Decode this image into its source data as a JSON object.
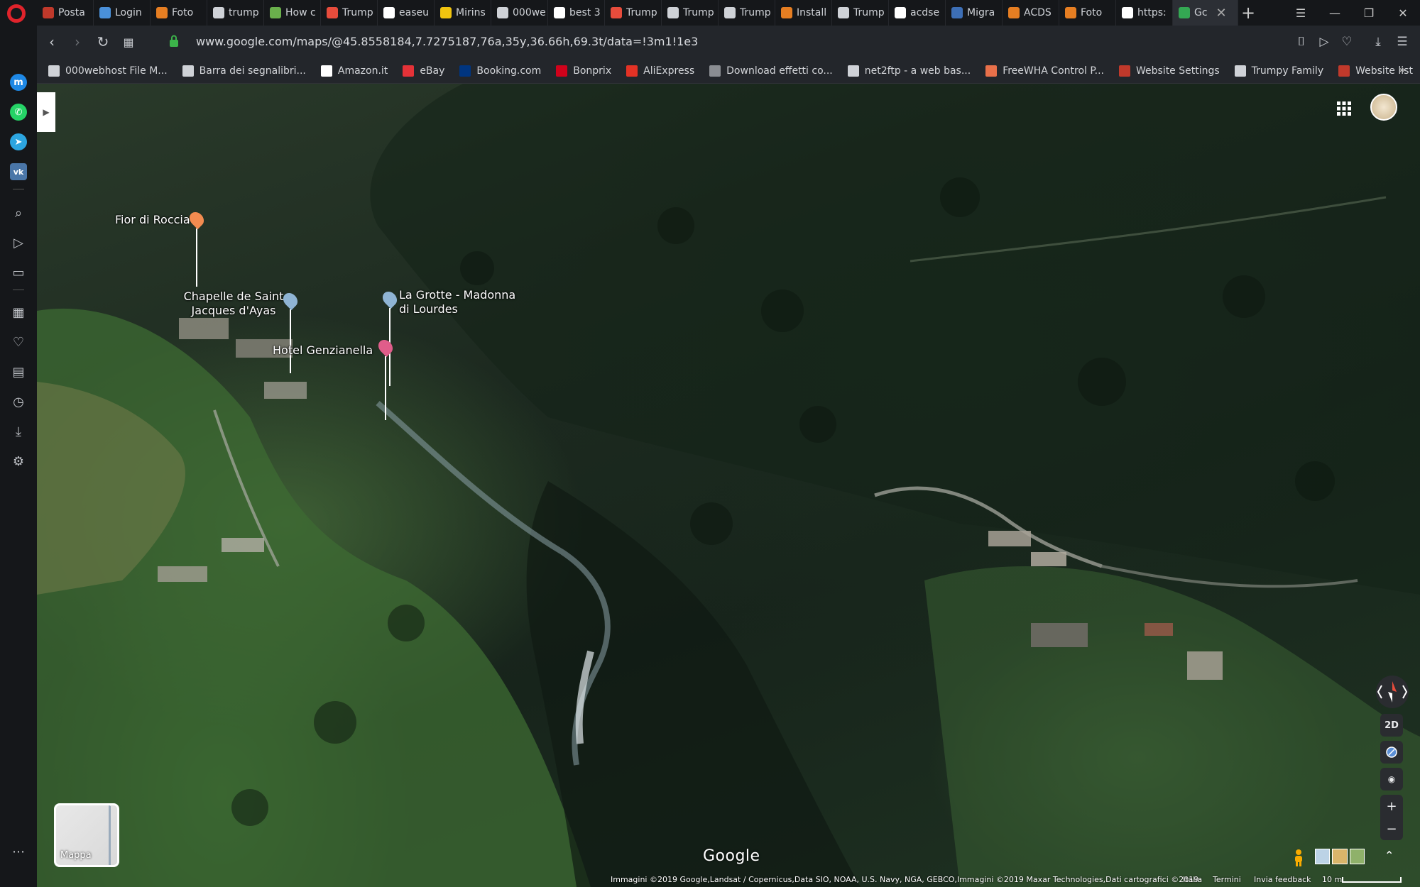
{
  "browser": {
    "tabs": [
      {
        "label": "Posta",
        "icon": "mail-icon",
        "color": "#c0392b"
      },
      {
        "label": "Login",
        "icon": "infinity-icon",
        "color": "#4a90d9"
      },
      {
        "label": "Foto",
        "icon": "photos-icon",
        "color": "#e67e22"
      },
      {
        "label": "trump",
        "icon": "document-icon",
        "color": "#cfd2d7"
      },
      {
        "label": "How c",
        "icon": "stack-icon",
        "color": "#6ab04c"
      },
      {
        "label": "Trump",
        "icon": "site-icon",
        "color": "#e74c3c"
      },
      {
        "label": "easeu",
        "icon": "google-icon",
        "color": "#ffffff"
      },
      {
        "label": "Mirins",
        "icon": "ms-icon",
        "color": "#f1c40f"
      },
      {
        "label": "000we",
        "icon": "document-icon",
        "color": "#cfd2d7"
      },
      {
        "label": "best 3",
        "icon": "google-icon",
        "color": "#ffffff"
      },
      {
        "label": "Trump",
        "icon": "site-icon",
        "color": "#e74c3c"
      },
      {
        "label": "Trump",
        "icon": "document-icon",
        "color": "#cfd2d7"
      },
      {
        "label": "Trump",
        "icon": "document-icon",
        "color": "#cfd2d7"
      },
      {
        "label": "Install",
        "icon": "acdsee-icon",
        "color": "#e67e22"
      },
      {
        "label": "Trump",
        "icon": "document-icon",
        "color": "#cfd2d7"
      },
      {
        "label": "acdse",
        "icon": "google-icon",
        "color": "#ffffff"
      },
      {
        "label": "Migra",
        "icon": "migrate-icon",
        "color": "#3d6fb6"
      },
      {
        "label": "ACDS",
        "icon": "acdsee-icon",
        "color": "#e67e22"
      },
      {
        "label": "Foto",
        "icon": "photos-icon",
        "color": "#e67e22"
      },
      {
        "label": "https:",
        "icon": "google-icon",
        "color": "#ffffff"
      },
      {
        "label": "Gc",
        "icon": "maps-icon",
        "color": "#34a853",
        "active": true
      }
    ],
    "new_tab": "+",
    "address": {
      "url": "www.google.com/maps/@45.8558184,7.7275187,76a,35y,36.66h,69.3t/data=!3m1!1e3"
    },
    "bookmarks": [
      {
        "label": "000webhost File M...",
        "icon": "document-icon",
        "color": "#cfd2d7"
      },
      {
        "label": "Barra dei segnalibri...",
        "icon": "folder-icon",
        "color": "#cfd2d7"
      },
      {
        "label": "Amazon.it",
        "icon": "amazon-icon",
        "color": "#ffffff"
      },
      {
        "label": "eBay",
        "icon": "ebay-icon",
        "color": "#e53238"
      },
      {
        "label": "Booking.com",
        "icon": "booking-icon",
        "color": "#003580"
      },
      {
        "label": "Bonprix",
        "icon": "bonprix-icon",
        "color": "#d0021b"
      },
      {
        "label": "AliExpress",
        "icon": "aliexpress-icon",
        "color": "#e43225"
      },
      {
        "label": "Download effetti co...",
        "icon": "document-icon",
        "color": "#8a8d92"
      },
      {
        "label": "net2ftp - a web bas...",
        "icon": "net2ftp-icon",
        "color": "#cfd2d7"
      },
      {
        "label": "FreeWHA Control P...",
        "icon": "freewha-icon",
        "color": "#e8704a"
      },
      {
        "label": "Website Settings",
        "icon": "site-icon",
        "color": "#c0392b"
      },
      {
        "label": "Trumpy Family",
        "icon": "document-icon",
        "color": "#cfd2d7"
      },
      {
        "label": "Website list",
        "icon": "site-icon",
        "color": "#c0392b"
      }
    ]
  },
  "map": {
    "places": [
      {
        "label": "Fior di Roccia",
        "icon": "food-pin-icon",
        "color": "#f28b50"
      },
      {
        "label": "Chapelle de Saint Jacques d'Ayas",
        "icon": "church-pin-icon",
        "color": "#8fb4d4"
      },
      {
        "label": "La Grotte - Madonna di Lourdes",
        "icon": "church-pin-icon",
        "color": "#8fb4d4"
      },
      {
        "label": "Hotel Genzianella",
        "icon": "hotel-pin-icon",
        "color": "#e05d8a"
      }
    ],
    "layer_toggle_label": "Mappa",
    "logo": "Google",
    "controls": {
      "view_2d": "2D",
      "zoom_in": "+",
      "zoom_out": "−"
    },
    "attribution": "Immagini ©2019 Google,Landsat / Copernicus,Data SIO, NOAA, U.S. Navy, NGA, GEBCO,Immagini ©2019 Maxar Technologies,Dati cartografici ©2019",
    "footer_links": [
      "Italia",
      "Termini",
      "Invia feedback"
    ],
    "scale_label": "10 m"
  }
}
